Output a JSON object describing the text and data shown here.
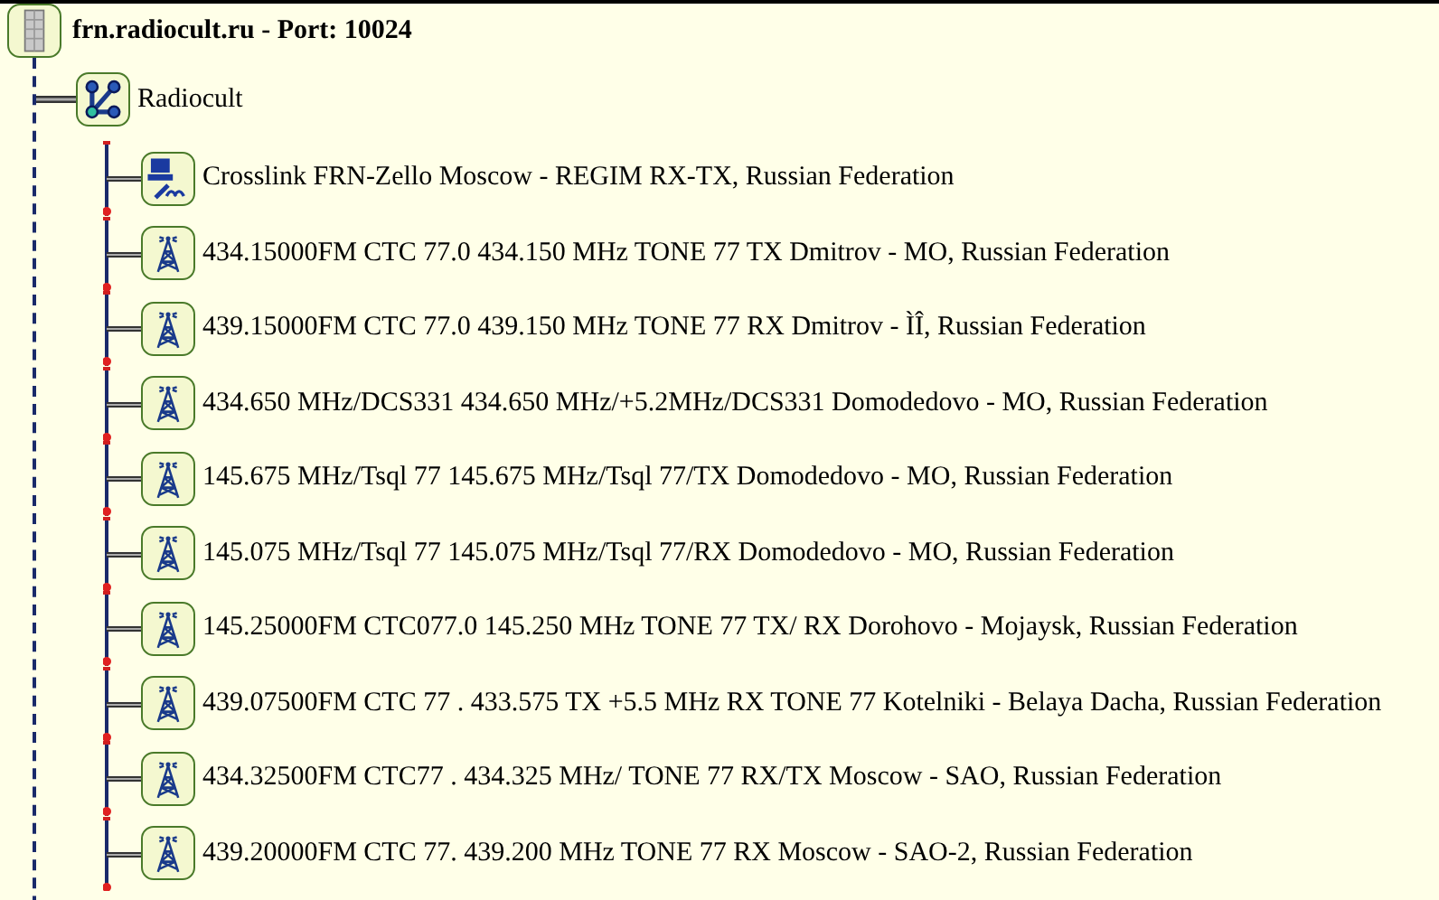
{
  "tree": {
    "label": "frn.radiocult.ru - Port: 10024",
    "kind": "server",
    "expanded": true,
    "children": [
      {
        "label": "Radiocult",
        "kind": "network",
        "expanded": true,
        "children": [
          {
            "label": "Crosslink FRN-Zello Moscow - REGIM RX-TX, Russian Federation",
            "kind": "crosslink"
          },
          {
            "label": "434.15000FM CTC 77.0 434.150 MHz TONE 77 TX Dmitrov - MO, Russian Federation",
            "kind": "tower"
          },
          {
            "label": "439.15000FM CTC 77.0 439.150 MHz TONE 77 RX Dmitrov - ÌÎ, Russian Federation",
            "kind": "tower"
          },
          {
            "label": "434.650 MHz/DCS331 434.650 MHz/+5.2MHz/DCS331 Domodedovo - MO, Russian Federation",
            "kind": "tower"
          },
          {
            "label": "145.675 MHz/Tsql 77 145.675 MHz/Tsql 77/TX Domodedovo - MO, Russian Federation",
            "kind": "tower"
          },
          {
            "label": "145.075 MHz/Tsql 77 145.075 MHz/Tsql 77/RX Domodedovo - MO, Russian Federation",
            "kind": "tower"
          },
          {
            "label": "145.25000FM CTC077.0 145.250 MHz TONE 77 TX/ RX Dorohovo - Mojaysk, Russian Federation",
            "kind": "tower"
          },
          {
            "label": "439.07500FM CTC 77 . 433.575 TX +5.5 MHz RX TONE 77 Kotelniki - Belaya Dacha, Russian Federation",
            "kind": "tower"
          },
          {
            "label": "434.32500FM CTC77 . 434.325 MHz/ TONE 77 RX/TX Moscow - SAO, Russian Federation",
            "kind": "tower"
          },
          {
            "label": "439.20000FM CTC 77. 439.200 MHz TONE 77 RX Moscow - SAO-2, Russian Federation",
            "kind": "tower"
          }
        ]
      }
    ]
  }
}
